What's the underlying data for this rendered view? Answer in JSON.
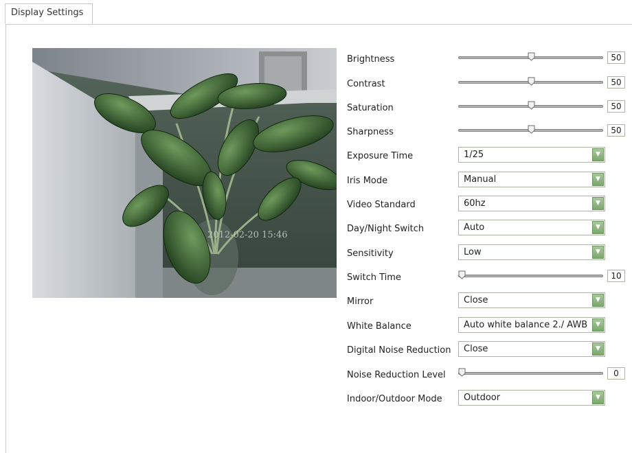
{
  "tab": {
    "label": "Display Settings"
  },
  "preview": {
    "osd_timestamp": "2012-02-20 15:46"
  },
  "controls": {
    "brightness": {
      "label": "Brightness",
      "value": "50",
      "level": 0.5
    },
    "contrast": {
      "label": "Contrast",
      "value": "50",
      "level": 0.5
    },
    "saturation": {
      "label": "Saturation",
      "value": "50",
      "level": 0.5
    },
    "sharpness": {
      "label": "Sharpness",
      "value": "50",
      "level": 0.5
    },
    "exposure_time": {
      "label": "Exposure Time",
      "value": "1/25"
    },
    "iris_mode": {
      "label": "Iris Mode",
      "value": "Manual"
    },
    "video_standard": {
      "label": "Video Standard",
      "value": "60hz"
    },
    "day_night_switch": {
      "label": "Day/Night Switch",
      "value": "Auto"
    },
    "sensitivity": {
      "label": "Sensitivity",
      "value": "Low"
    },
    "switch_time": {
      "label": "Switch Time",
      "value": "10",
      "level": 0.0
    },
    "mirror": {
      "label": "Mirror",
      "value": "Close"
    },
    "white_balance": {
      "label": "White Balance",
      "value": "Auto white balance 2./ AWB"
    },
    "digital_noise_reduction": {
      "label": "Digital Noise Reduction",
      "value": "Close"
    },
    "noise_reduction_level": {
      "label": "Noise Reduction Level",
      "value": "0",
      "level": 0.0
    },
    "indoor_outdoor_mode": {
      "label": "Indoor/Outdoor Mode",
      "value": "Outdoor"
    }
  },
  "icons": {
    "dropdown": "chevron-down-icon",
    "slider_thumb": "slider-thumb-icon"
  },
  "colors": {
    "dropdown_button": "#8bb57c",
    "border": "#a9b4a4"
  }
}
